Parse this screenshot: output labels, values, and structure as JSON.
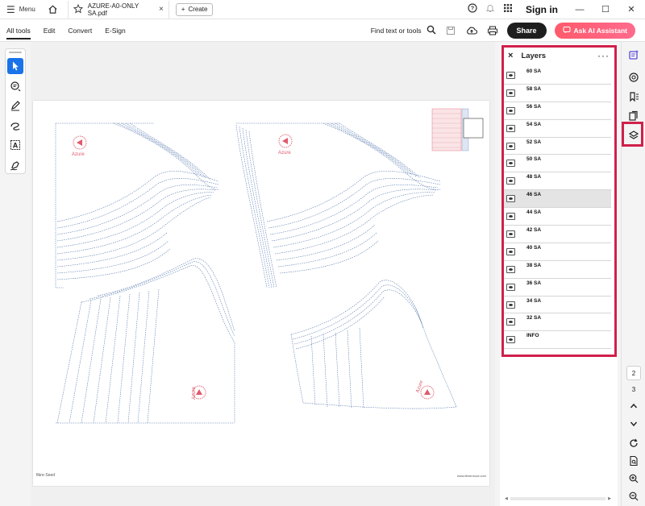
{
  "titlebar": {
    "menu_label": "Menu",
    "tab_title": "AZURE-A0-ONLY SA.pdf",
    "tab_close": "×",
    "create_label": "Create",
    "signin_label": "Sign in",
    "window_minimize": "—",
    "window_maximize": "☐",
    "window_close": "✕"
  },
  "toolbar": {
    "tabs": [
      "All tools",
      "Edit",
      "Convert",
      "E-Sign"
    ],
    "find_label": "Find text or tools",
    "share_label": "Share",
    "ai_label": "Ask AI Assistant"
  },
  "document": {
    "brand_left": "fibre·Seed",
    "brand_right": "www.fibremood.com",
    "pattern_label": "Azure",
    "accent_color": "#e05a6b",
    "line_color": "#4a6fa8"
  },
  "layers_panel": {
    "title": "Layers",
    "close_glyph": "×",
    "more_glyph": "···",
    "selected_index": 7,
    "items": [
      "60 SA",
      "58 SA",
      "56 SA",
      "54 SA",
      "52 SA",
      "50 SA",
      "48 SA",
      "46 SA",
      "44 SA",
      "42 SA",
      "40 SA",
      "38 SA",
      "36 SA",
      "34 SA",
      "32 SA",
      "INFO"
    ]
  },
  "right_rail": {
    "page_current": "2",
    "page_next": "3"
  },
  "colors": {
    "highlight_frame": "#d0204a",
    "tool_selected": "#1a73e8",
    "share_bg": "#1e1e1e",
    "ai_gradient_start": "#ff5a6b"
  }
}
